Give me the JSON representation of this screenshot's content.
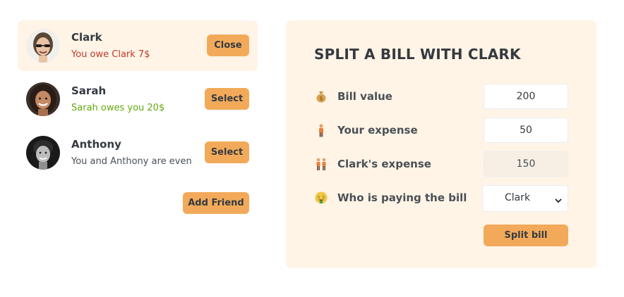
{
  "friends": [
    {
      "name": "Clark",
      "status": "You owe Clark 7$",
      "button": "Close",
      "selected": true,
      "avatar": "clark-avatar"
    },
    {
      "name": "Sarah",
      "status": "Sarah owes you 20$",
      "button": "Select",
      "selected": false,
      "avatar": "sarah-avatar"
    },
    {
      "name": "Anthony",
      "status": "You and Anthony are even",
      "button": "Select",
      "selected": false,
      "avatar": "anthony-avatar"
    }
  ],
  "add_friend_label": "Add Friend",
  "split": {
    "title": "SPLIT A BILL WITH CLARK",
    "bill_label": "Bill value",
    "bill_value": "200",
    "bill_icon": "money-bag-icon",
    "expense_label": "Your expense",
    "expense_value": "50",
    "expense_icon": "person-icon",
    "friend_expense_label": "Clark's expense",
    "friend_expense_value": "150",
    "friend_expense_icon": "two-people-icon",
    "payer_label": "Who is paying the bill",
    "payer_value": "Clark",
    "payer_icon": "money-face-icon",
    "submit_label": "Split bill"
  },
  "colors": {
    "accent": "#f2aa5a",
    "panel_bg": "#fff4e6",
    "owe_red": "#c0392b",
    "owed_green": "#66a80f"
  }
}
